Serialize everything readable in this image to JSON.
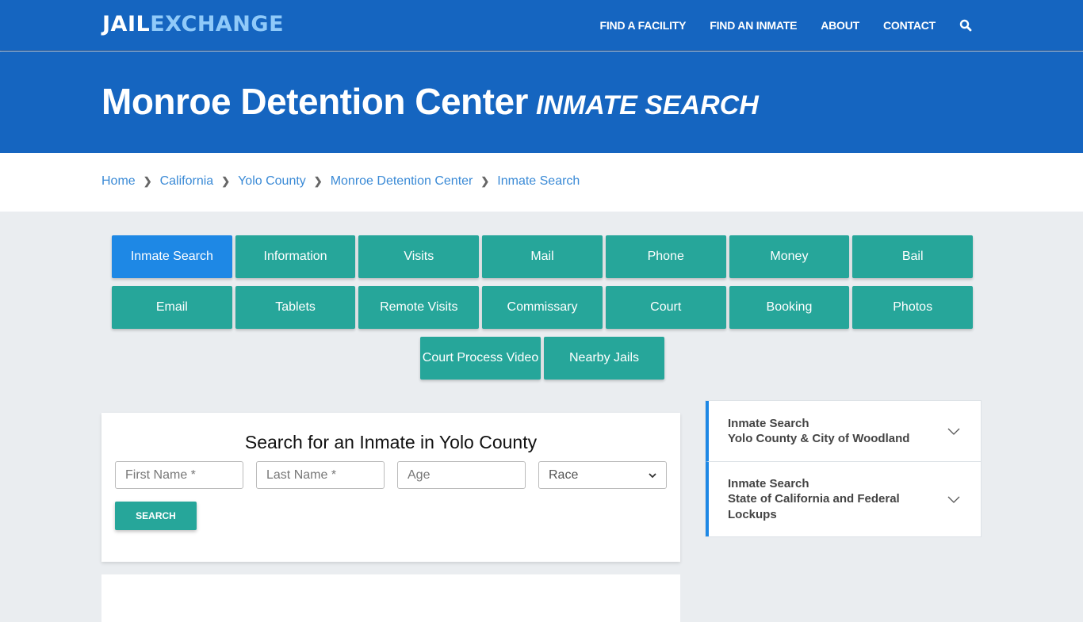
{
  "brand": {
    "logo_part1": "JAIL",
    "logo_part2": "EXCHANGE"
  },
  "nav": {
    "items": [
      "FIND A FACILITY",
      "FIND AN INMATE",
      "ABOUT",
      "CONTACT"
    ],
    "search_icon": "search-icon"
  },
  "hero": {
    "title": "Monroe Detention Center",
    "subtitle": "INMATE SEARCH"
  },
  "breadcrumb": [
    "Home",
    "California",
    "Yolo County",
    "Monroe Detention Center",
    "Inmate Search"
  ],
  "tabs": {
    "row1": [
      "Inmate Search",
      "Information",
      "Visits",
      "Mail",
      "Phone",
      "Money",
      "Bail"
    ],
    "row2": [
      "Email",
      "Tablets",
      "Remote Visits",
      "Commissary",
      "Court",
      "Booking",
      "Photos"
    ],
    "row3": [
      "Court Process Video",
      "Nearby Jails"
    ],
    "active": "Inmate Search"
  },
  "search_form": {
    "heading": "Search for an Inmate in Yolo County",
    "first_name_placeholder": "First Name *",
    "last_name_placeholder": "Last Name *",
    "age_placeholder": "Age",
    "race_selected": "Race",
    "submit_label": "SEARCH"
  },
  "sidebar": {
    "items": [
      {
        "line1": "Inmate Search",
        "line2": "Yolo County & City of Woodland"
      },
      {
        "line1": "Inmate Search",
        "line2": "State of California and Federal Lockups"
      }
    ]
  },
  "colors": {
    "primary": "#1565c0",
    "teal": "#26a69a",
    "active_tab": "#1e88e5",
    "link": "#3a8ad6"
  }
}
